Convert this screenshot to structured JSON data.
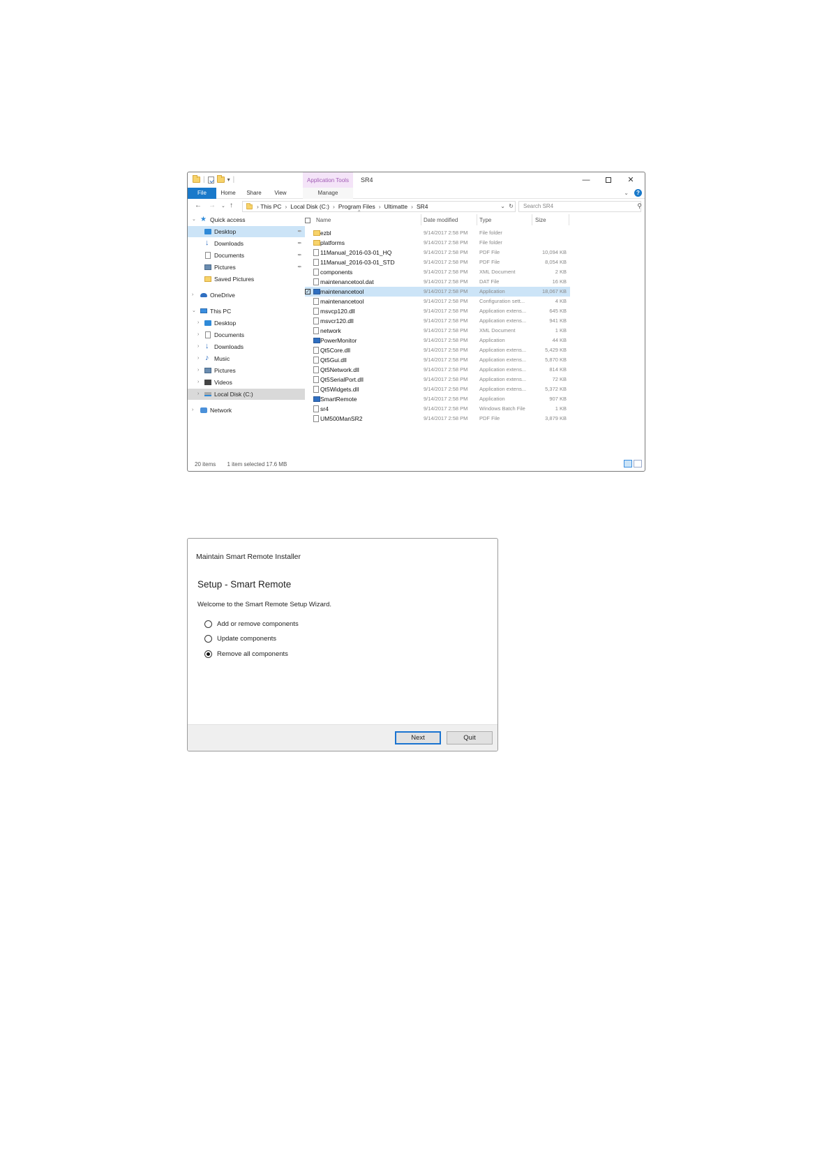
{
  "explorer": {
    "context_tab": "Application Tools",
    "title": "SR4",
    "ribbon_tabs": [
      "File",
      "Home",
      "Share",
      "View",
      "Manage"
    ],
    "breadcrumb": [
      "This PC",
      "Local Disk (C:)",
      "Program Files",
      "Ultimatte",
      "SR4"
    ],
    "search_placeholder": "Search SR4",
    "columns": [
      "Name",
      "Date modified",
      "Type",
      "Size"
    ],
    "nav": [
      {
        "label": "Quick access",
        "icon": "quick-access-star-icon"
      },
      {
        "label": "Desktop",
        "icon": "desktop-icon"
      },
      {
        "label": "Downloads",
        "icon": "downloads-icon"
      },
      {
        "label": "Documents",
        "icon": "documents-icon"
      },
      {
        "label": "Pictures",
        "icon": "pictures-icon"
      },
      {
        "label": "Saved Pictures",
        "icon": "folder-icon"
      },
      {
        "label": "OneDrive",
        "icon": "onedrive-icon"
      },
      {
        "label": "This PC",
        "icon": "this-pc-icon"
      },
      {
        "label": "Desktop",
        "icon": "desktop-icon"
      },
      {
        "label": "Documents",
        "icon": "documents-icon"
      },
      {
        "label": "Downloads",
        "icon": "downloads-icon"
      },
      {
        "label": "Music",
        "icon": "music-icon"
      },
      {
        "label": "Pictures",
        "icon": "pictures-icon"
      },
      {
        "label": "Videos",
        "icon": "videos-icon"
      },
      {
        "label": "Local Disk (C:)",
        "icon": "local-disk-icon"
      },
      {
        "label": "Network",
        "icon": "network-icon"
      }
    ],
    "files": [
      {
        "name": "ezbl",
        "date": "9/14/2017 2:58 PM",
        "type": "File folder",
        "size": ""
      },
      {
        "name": "platforms",
        "date": "9/14/2017 2:58 PM",
        "type": "File folder",
        "size": ""
      },
      {
        "name": "11Manual_2016-03-01_HQ",
        "date": "9/14/2017 2:58 PM",
        "type": "PDF File",
        "size": "10,094 KB"
      },
      {
        "name": "11Manual_2016-03-01_STD",
        "date": "9/14/2017 2:58 PM",
        "type": "PDF File",
        "size": "8,054 KB"
      },
      {
        "name": "components",
        "date": "9/14/2017 2:58 PM",
        "type": "XML Document",
        "size": "2 KB"
      },
      {
        "name": "maintenancetool.dat",
        "date": "9/14/2017 2:58 PM",
        "type": "DAT File",
        "size": "16 KB"
      },
      {
        "name": "maintenancetool",
        "date": "9/14/2017 2:58 PM",
        "type": "Application",
        "size": "18,067 KB"
      },
      {
        "name": "maintenancetool",
        "date": "9/14/2017 2:58 PM",
        "type": "Configuration sett...",
        "size": "4 KB"
      },
      {
        "name": "msvcp120.dll",
        "date": "9/14/2017 2:58 PM",
        "type": "Application extens...",
        "size": "645 KB"
      },
      {
        "name": "msvcr120.dll",
        "date": "9/14/2017 2:58 PM",
        "type": "Application extens...",
        "size": "941 KB"
      },
      {
        "name": "network",
        "date": "9/14/2017 2:58 PM",
        "type": "XML Document",
        "size": "1 KB"
      },
      {
        "name": "PowerMonitor",
        "date": "9/14/2017 2:58 PM",
        "type": "Application",
        "size": "44 KB"
      },
      {
        "name": "Qt5Core.dll",
        "date": "9/14/2017 2:58 PM",
        "type": "Application extens...",
        "size": "5,429 KB"
      },
      {
        "name": "Qt5Gui.dll",
        "date": "9/14/2017 2:58 PM",
        "type": "Application extens...",
        "size": "5,870 KB"
      },
      {
        "name": "Qt5Network.dll",
        "date": "9/14/2017 2:58 PM",
        "type": "Application extens...",
        "size": "814 KB"
      },
      {
        "name": "Qt5SerialPort.dll",
        "date": "9/14/2017 2:58 PM",
        "type": "Application extens...",
        "size": "72 KB"
      },
      {
        "name": "Qt5Widgets.dll",
        "date": "9/14/2017 2:58 PM",
        "type": "Application extens...",
        "size": "5,372 KB"
      },
      {
        "name": "SmartRemote",
        "date": "9/14/2017 2:58 PM",
        "type": "Application",
        "size": "907 KB"
      },
      {
        "name": "sr4",
        "date": "9/14/2017 2:58 PM",
        "type": "Windows Batch File",
        "size": "1 KB"
      },
      {
        "name": "UM500ManSR2",
        "date": "9/14/2017 2:58 PM",
        "type": "PDF File",
        "size": "3,879 KB"
      }
    ],
    "status": {
      "count": "20 items",
      "selection": "1 item selected  17.6 MB"
    }
  },
  "installer": {
    "title": "Maintain Smart Remote Installer",
    "heading": "Setup - Smart Remote",
    "welcome": "Welcome to the Smart Remote Setup Wizard.",
    "options": [
      {
        "label": "Add or remove components",
        "selected": false
      },
      {
        "label": "Update components",
        "selected": false
      },
      {
        "label": "Remove all components",
        "selected": true
      }
    ],
    "next_label": "Next",
    "quit_label": "Quit"
  },
  "colors": {
    "accent": "#1979ca",
    "selection": "#cce4f7",
    "context_tab": "#f4e4f8"
  }
}
